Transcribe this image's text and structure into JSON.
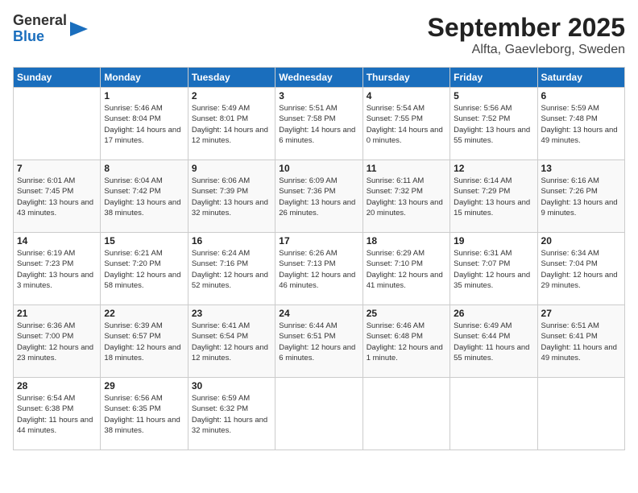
{
  "logo": {
    "text_general": "General",
    "text_blue": "Blue"
  },
  "title": "September 2025",
  "subtitle": "Alfta, Gaevleborg, Sweden",
  "days": [
    "Sunday",
    "Monday",
    "Tuesday",
    "Wednesday",
    "Thursday",
    "Friday",
    "Saturday"
  ],
  "weeks": [
    [
      {
        "date": "",
        "sunrise": "",
        "sunset": "",
        "daylight": ""
      },
      {
        "date": "1",
        "sunrise": "5:46 AM",
        "sunset": "8:04 PM",
        "daylight": "14 hours and 17 minutes."
      },
      {
        "date": "2",
        "sunrise": "5:49 AM",
        "sunset": "8:01 PM",
        "daylight": "14 hours and 12 minutes."
      },
      {
        "date": "3",
        "sunrise": "5:51 AM",
        "sunset": "7:58 PM",
        "daylight": "14 hours and 6 minutes."
      },
      {
        "date": "4",
        "sunrise": "5:54 AM",
        "sunset": "7:55 PM",
        "daylight": "14 hours and 0 minutes."
      },
      {
        "date": "5",
        "sunrise": "5:56 AM",
        "sunset": "7:52 PM",
        "daylight": "13 hours and 55 minutes."
      },
      {
        "date": "6",
        "sunrise": "5:59 AM",
        "sunset": "7:48 PM",
        "daylight": "13 hours and 49 minutes."
      }
    ],
    [
      {
        "date": "7",
        "sunrise": "6:01 AM",
        "sunset": "7:45 PM",
        "daylight": "13 hours and 43 minutes."
      },
      {
        "date": "8",
        "sunrise": "6:04 AM",
        "sunset": "7:42 PM",
        "daylight": "13 hours and 38 minutes."
      },
      {
        "date": "9",
        "sunrise": "6:06 AM",
        "sunset": "7:39 PM",
        "daylight": "13 hours and 32 minutes."
      },
      {
        "date": "10",
        "sunrise": "6:09 AM",
        "sunset": "7:36 PM",
        "daylight": "13 hours and 26 minutes."
      },
      {
        "date": "11",
        "sunrise": "6:11 AM",
        "sunset": "7:32 PM",
        "daylight": "13 hours and 20 minutes."
      },
      {
        "date": "12",
        "sunrise": "6:14 AM",
        "sunset": "7:29 PM",
        "daylight": "13 hours and 15 minutes."
      },
      {
        "date": "13",
        "sunrise": "6:16 AM",
        "sunset": "7:26 PM",
        "daylight": "13 hours and 9 minutes."
      }
    ],
    [
      {
        "date": "14",
        "sunrise": "6:19 AM",
        "sunset": "7:23 PM",
        "daylight": "13 hours and 3 minutes."
      },
      {
        "date": "15",
        "sunrise": "6:21 AM",
        "sunset": "7:20 PM",
        "daylight": "12 hours and 58 minutes."
      },
      {
        "date": "16",
        "sunrise": "6:24 AM",
        "sunset": "7:16 PM",
        "daylight": "12 hours and 52 minutes."
      },
      {
        "date": "17",
        "sunrise": "6:26 AM",
        "sunset": "7:13 PM",
        "daylight": "12 hours and 46 minutes."
      },
      {
        "date": "18",
        "sunrise": "6:29 AM",
        "sunset": "7:10 PM",
        "daylight": "12 hours and 41 minutes."
      },
      {
        "date": "19",
        "sunrise": "6:31 AM",
        "sunset": "7:07 PM",
        "daylight": "12 hours and 35 minutes."
      },
      {
        "date": "20",
        "sunrise": "6:34 AM",
        "sunset": "7:04 PM",
        "daylight": "12 hours and 29 minutes."
      }
    ],
    [
      {
        "date": "21",
        "sunrise": "6:36 AM",
        "sunset": "7:00 PM",
        "daylight": "12 hours and 23 minutes."
      },
      {
        "date": "22",
        "sunrise": "6:39 AM",
        "sunset": "6:57 PM",
        "daylight": "12 hours and 18 minutes."
      },
      {
        "date": "23",
        "sunrise": "6:41 AM",
        "sunset": "6:54 PM",
        "daylight": "12 hours and 12 minutes."
      },
      {
        "date": "24",
        "sunrise": "6:44 AM",
        "sunset": "6:51 PM",
        "daylight": "12 hours and 6 minutes."
      },
      {
        "date": "25",
        "sunrise": "6:46 AM",
        "sunset": "6:48 PM",
        "daylight": "12 hours and 1 minute."
      },
      {
        "date": "26",
        "sunrise": "6:49 AM",
        "sunset": "6:44 PM",
        "daylight": "11 hours and 55 minutes."
      },
      {
        "date": "27",
        "sunrise": "6:51 AM",
        "sunset": "6:41 PM",
        "daylight": "11 hours and 49 minutes."
      }
    ],
    [
      {
        "date": "28",
        "sunrise": "6:54 AM",
        "sunset": "6:38 PM",
        "daylight": "11 hours and 44 minutes."
      },
      {
        "date": "29",
        "sunrise": "6:56 AM",
        "sunset": "6:35 PM",
        "daylight": "11 hours and 38 minutes."
      },
      {
        "date": "30",
        "sunrise": "6:59 AM",
        "sunset": "6:32 PM",
        "daylight": "11 hours and 32 minutes."
      },
      {
        "date": "",
        "sunrise": "",
        "sunset": "",
        "daylight": ""
      },
      {
        "date": "",
        "sunrise": "",
        "sunset": "",
        "daylight": ""
      },
      {
        "date": "",
        "sunrise": "",
        "sunset": "",
        "daylight": ""
      },
      {
        "date": "",
        "sunrise": "",
        "sunset": "",
        "daylight": ""
      }
    ]
  ]
}
